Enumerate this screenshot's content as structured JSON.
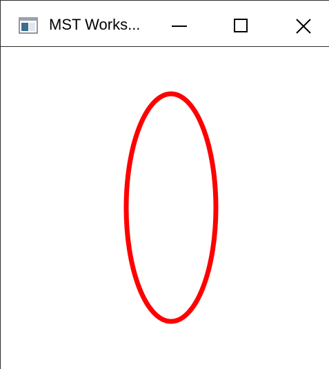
{
  "window": {
    "title": "MST Works...",
    "app_icon": "app-window-icon",
    "controls": {
      "minimize_icon": "minimize-icon",
      "maximize_icon": "maximize-icon",
      "close_icon": "close-icon"
    }
  },
  "canvas": {
    "background": "#ffffff",
    "shape": {
      "kind": "ellipse",
      "stroke_color": "#ff0000",
      "fill": "none"
    }
  }
}
